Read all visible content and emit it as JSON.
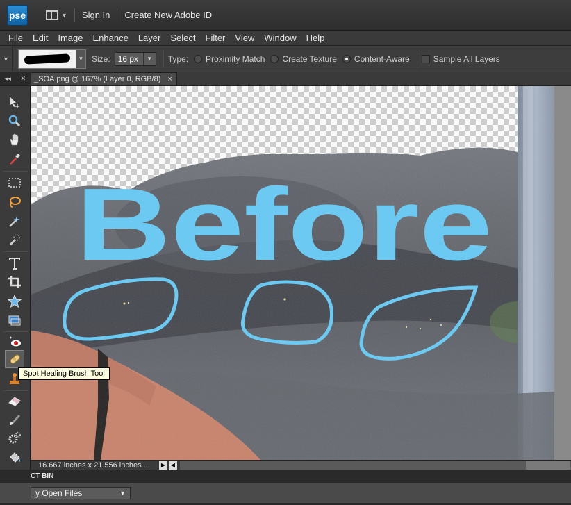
{
  "app": {
    "logo_text": "pse",
    "sign_in": "Sign In",
    "create_id": "Create New Adobe ID"
  },
  "menu": [
    "File",
    "Edit",
    "Image",
    "Enhance",
    "Layer",
    "Select",
    "Filter",
    "View",
    "Window",
    "Help"
  ],
  "options": {
    "size_label": "Size:",
    "size_value": "16 px",
    "type_label": "Type:",
    "types": [
      {
        "label": "Proximity Match",
        "selected": false
      },
      {
        "label": "Create Texture",
        "selected": false
      },
      {
        "label": "Content-Aware",
        "selected": true
      }
    ],
    "sample_all_layers": "Sample All Layers"
  },
  "document": {
    "tab_title": "_SOA.png @ 167% (Layer 0, RGB/8)",
    "tab_close": "×"
  },
  "canvas": {
    "overlay_text": "Before"
  },
  "tooltip": {
    "text": "Spot Healing Brush Tool"
  },
  "status": {
    "dimensions": "16.667 inches x 21.556 inches ..."
  },
  "bin": {
    "title": "CT BIN",
    "select_value": "y Open Files"
  },
  "colors": {
    "accent_blue": "#6ccaf2",
    "logo_blue": "#1f79c2"
  }
}
